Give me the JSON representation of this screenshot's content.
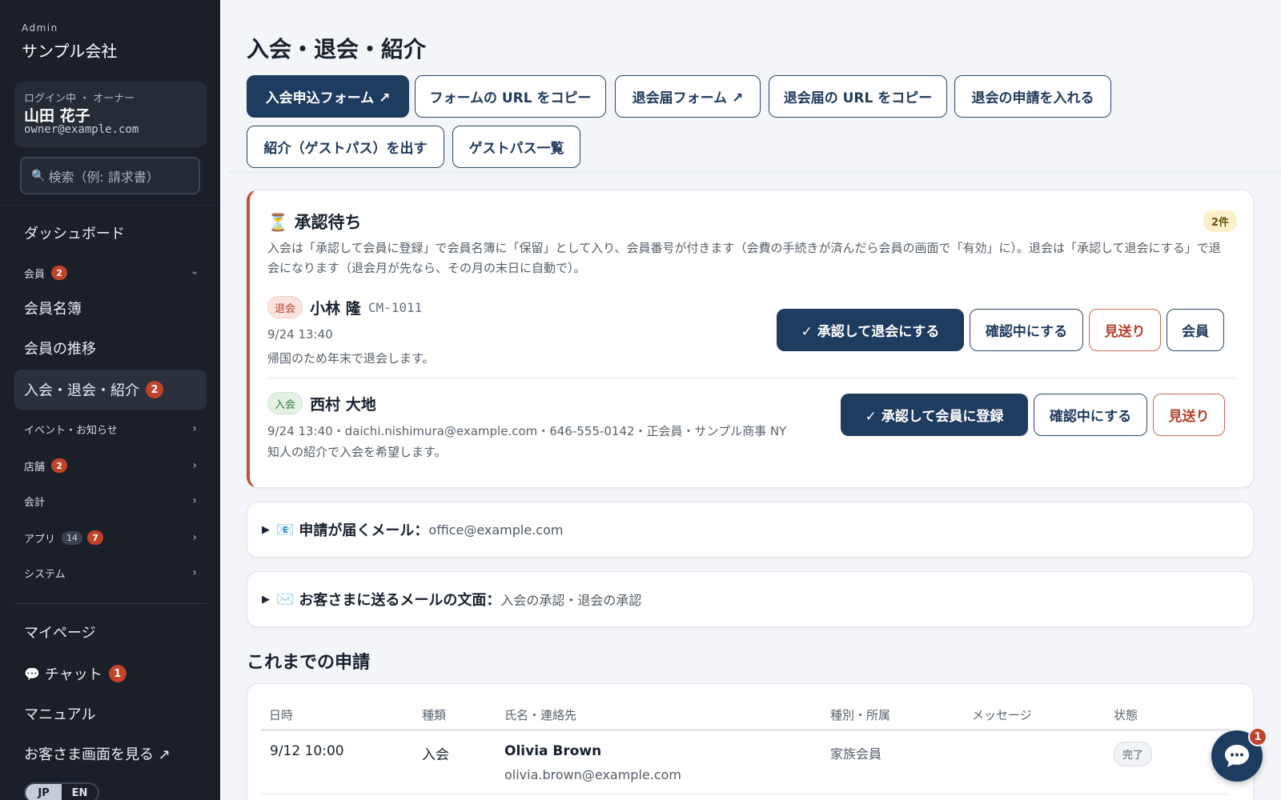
{
  "sidebar": {
    "eyebrow": "Admin",
    "brand": "サンプル会社",
    "user": {
      "role": "ログイン中 ・ オーナー",
      "name": "山田 花子",
      "email": "owner@example.com"
    },
    "search_placeholder": "検索（例: 請求書）",
    "nav": {
      "dashboard": "ダッシュボード",
      "members_group": {
        "label": "会員",
        "badge": "2"
      },
      "member_list": "会員名簿",
      "member_trend": "会員の推移",
      "join_leave": {
        "label": "入会・退会・紹介",
        "badge": "2"
      },
      "events": "イベント・お知らせ",
      "stores": {
        "label": "店舗",
        "badge": "2"
      },
      "accounting": "会計",
      "apps": {
        "label": "アプリ",
        "count": "14",
        "badge": "7"
      },
      "system": "システム",
      "mypage": "マイページ",
      "chat": {
        "label": "チャット",
        "badge": "1"
      },
      "manual": "マニュアル",
      "customer_view": "お客さま画面を見る ↗"
    },
    "lang": {
      "jp": "JP",
      "en": "EN",
      "active": "JP"
    }
  },
  "page": {
    "title": "入会・退会・紹介",
    "toolbar": {
      "join_form": "入会申込フォーム ↗",
      "copy_form_url": "フォームの URL をコピー",
      "leave_form": "退会届フォーム ↗",
      "copy_leave_url": "退会届の URL をコピー",
      "add_leave_request": "退会の申請を入れる",
      "issue_guest_pass": "紹介（ゲストパス）を出す",
      "guest_pass_list": "ゲストパス一覧"
    }
  },
  "pending": {
    "icon": "hourglass-icon",
    "title": "承認待ち",
    "count": "2件",
    "description": "入会は「承認して会員に登録」で会員名簿に「保留」として入り、会員番号が付きます（会費の手続きが済んだら会員の画面で「有効」に）。退会は「承認して退会にする」で退会になります（退会月が先なら、その月の末日に自動で）。",
    "requests": [
      {
        "type": "退会",
        "name": "小林 隆",
        "code": "CM-1011",
        "meta": "9/24 13:40",
        "message": "帰国のため年末で退会します。",
        "actions": {
          "approve": "✓ 承認して退会にする",
          "review": "確認中にする",
          "decline": "見送り",
          "member": "会員"
        }
      },
      {
        "type": "入会",
        "name": "西村 大地",
        "meta": "9/24 13:40・daichi.nishimura@example.com・646-555-0142・正会員・サンプル商事 NY",
        "message": "知人の紹介で入会を希望します。",
        "actions": {
          "approve": "✓ 承認して会員に登録",
          "review": "確認中にする",
          "decline": "見送り"
        }
      }
    ]
  },
  "notify_email": {
    "label": "申請が届くメール：",
    "value": "office@example.com"
  },
  "customer_email": {
    "label": "お客さまに送るメールの文面：",
    "value": "入会の承認・退会の承認"
  },
  "history": {
    "title": "これまでの申請",
    "columns": [
      "日時",
      "種類",
      "氏名・連絡先",
      "種別・所属",
      "メッセージ",
      "状態"
    ],
    "rows": [
      {
        "datetime": "9/12 10:00",
        "type": "入会",
        "name": "Olivia Brown",
        "email": "olivia.brown@example.com",
        "category": "家族会員",
        "message": "",
        "status": "完了"
      }
    ]
  },
  "chat_fab": {
    "badge": "1"
  },
  "colors": {
    "sidebar_bg": "#1a1f28",
    "primary": "#1e3b60",
    "danger": "#b5412a",
    "badge_red": "#c0432a"
  }
}
